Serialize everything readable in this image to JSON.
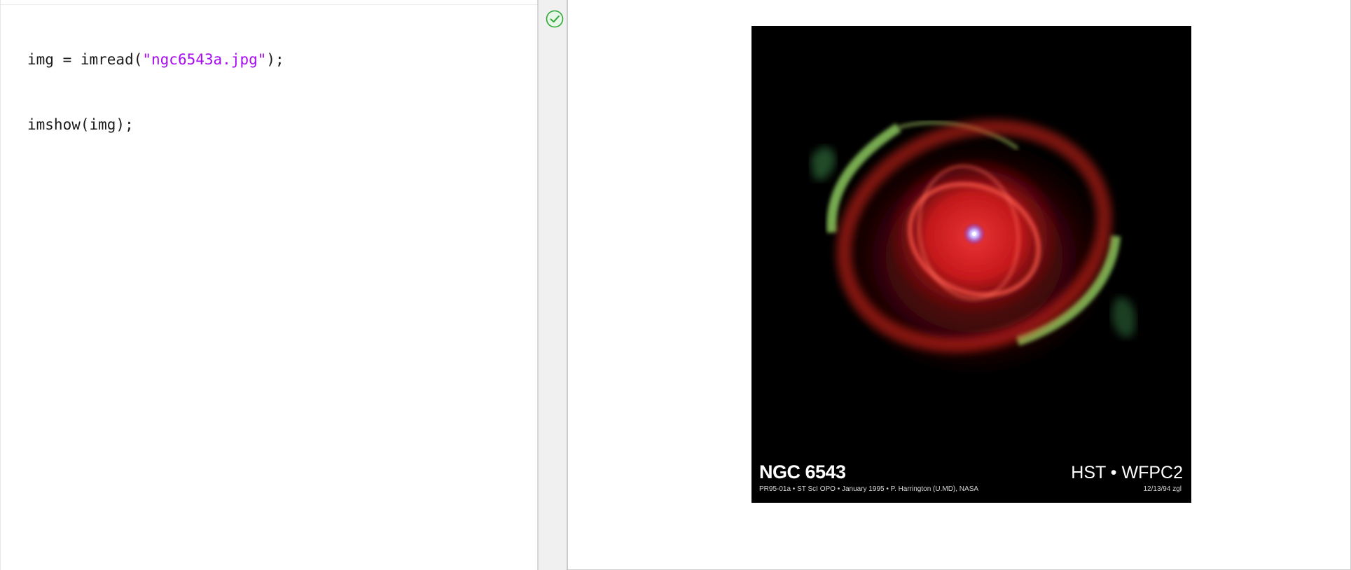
{
  "editor": {
    "lines": [
      {
        "pre": "img = imread(",
        "str": "\"ngc6543a.jpg\"",
        "post": ");"
      },
      {
        "pre": "imshow(img);",
        "str": "",
        "post": ""
      }
    ],
    "status_icon": "check-circle-icon",
    "string_color": "#a709f5",
    "status_color": "#2ea836"
  },
  "figure": {
    "image": {
      "title": "NGC 6543",
      "instrument": "HST • WFPC2",
      "credit": "PR95-01a • ST ScI OPO • January 1995 • P. Harrington (U.MD), NASA",
      "date": "12/13/94 zgl"
    }
  }
}
